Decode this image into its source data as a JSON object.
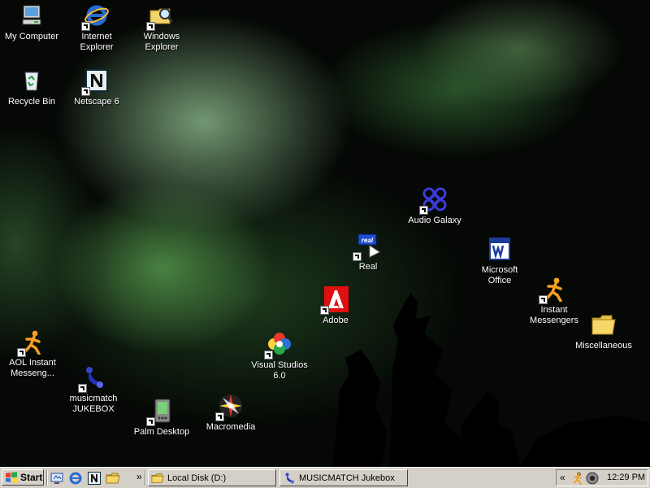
{
  "desktop": {
    "icons": {
      "my_computer": "My Computer",
      "internet_explorer": "Internet\nExplorer",
      "windows_explorer": "Windows\nExplorer",
      "recycle_bin": "Recycle Bin",
      "netscape": "Netscape 6",
      "audio_galaxy": "Audio Galaxy",
      "real": "Real",
      "microsoft_office": "Microsoft\nOffice",
      "instant_messengers": "Instant\nMessengers",
      "adobe": "Adobe",
      "miscellaneous": "Miscellaneous",
      "aol_instant": "AOL Instant\nMesseng...",
      "visual_studios": "Visual Studios\n6.0",
      "musicmatch": "musicmatch\nJUKEBOX",
      "palm_desktop": "Palm Desktop",
      "macromedia": "Macromedia"
    }
  },
  "taskbar": {
    "start_label": "Start",
    "overflow_chevron": "»",
    "tasks": {
      "local_disk": "Local Disk (D:)",
      "musicmatch": "MUSICMATCH Jukebox"
    },
    "tray": {
      "chevron": "«",
      "clock": "12:29 PM"
    }
  }
}
